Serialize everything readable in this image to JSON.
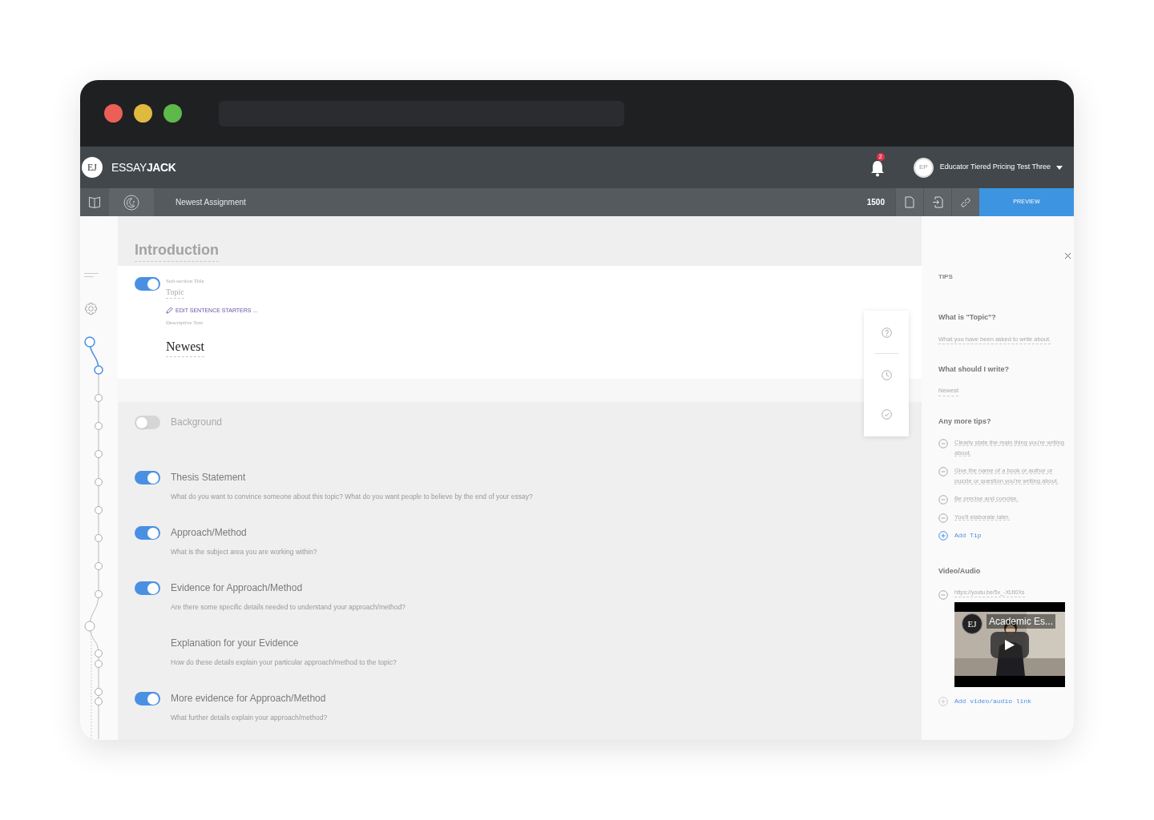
{
  "window": {
    "traffic_lights": [
      {
        "color": "#ec5f57"
      },
      {
        "color": "#e0b93f"
      },
      {
        "color": "#5cb94a"
      }
    ]
  },
  "app": {
    "logo": "EJ",
    "brand_light": "ESSAY",
    "brand_bold": "JACK",
    "notifications": "2",
    "user": {
      "initials": "EP",
      "name": "Educator Tiered Pricing Test Three"
    }
  },
  "toolbar": {
    "assignment": "Newest Assignment",
    "word_count": "1500",
    "preview": "PREVIEW"
  },
  "section": {
    "title": "Introduction",
    "active": {
      "on": true,
      "subtitle_label": "Sub-section Title",
      "subtitle": "Topic",
      "edit_link": "EDIT SENTENCE STARTERS ...",
      "text_label": "Descriptive Text",
      "text": "Newest"
    },
    "subsections": [
      {
        "kind": "toggle",
        "on": false,
        "title": "Background"
      },
      {
        "kind": "toggle",
        "on": true,
        "title": "Thesis Statement",
        "prompt": "What do you want to convince someone about this topic? What do you want people to believe by the end of your essay?"
      },
      {
        "kind": "toggle",
        "on": true,
        "title": "Approach/Method",
        "prompt": "What is the subject area you are working within?"
      },
      {
        "kind": "toggle",
        "on": true,
        "title": "Evidence for Approach/Method",
        "prompt": "Are there some specific details needed to understand your approach/method?"
      },
      {
        "kind": "plain",
        "title": "Explanation for your Evidence",
        "prompt": "How do these details explain your particular approach/method to the topic?"
      },
      {
        "kind": "toggle",
        "on": true,
        "title": "More evidence for Approach/Method",
        "prompt": "What further details explain your approach/method?"
      }
    ]
  },
  "tips": {
    "heading": "TIPS",
    "blocks": [
      {
        "question": "What is \"Topic\"?",
        "answer": "What you have been asked to write about."
      },
      {
        "question": "What should I write?",
        "answer": "Newest"
      }
    ],
    "more_heading": "Any more tips?",
    "items": [
      "Clearly state the main thing you're writing about.",
      "Give the name of a book or author or puzzle or question you're writing about.",
      "Be precise and concise.",
      "You'll elaborate later."
    ],
    "add_tip": "Add Tip",
    "media_heading": "Video/Audio",
    "media_link": "https://youtu.be/5x_-XtJt0Xs",
    "video_title": "Academic Es...",
    "video_logo": "EJ",
    "add_media": "Add video/audio link"
  }
}
